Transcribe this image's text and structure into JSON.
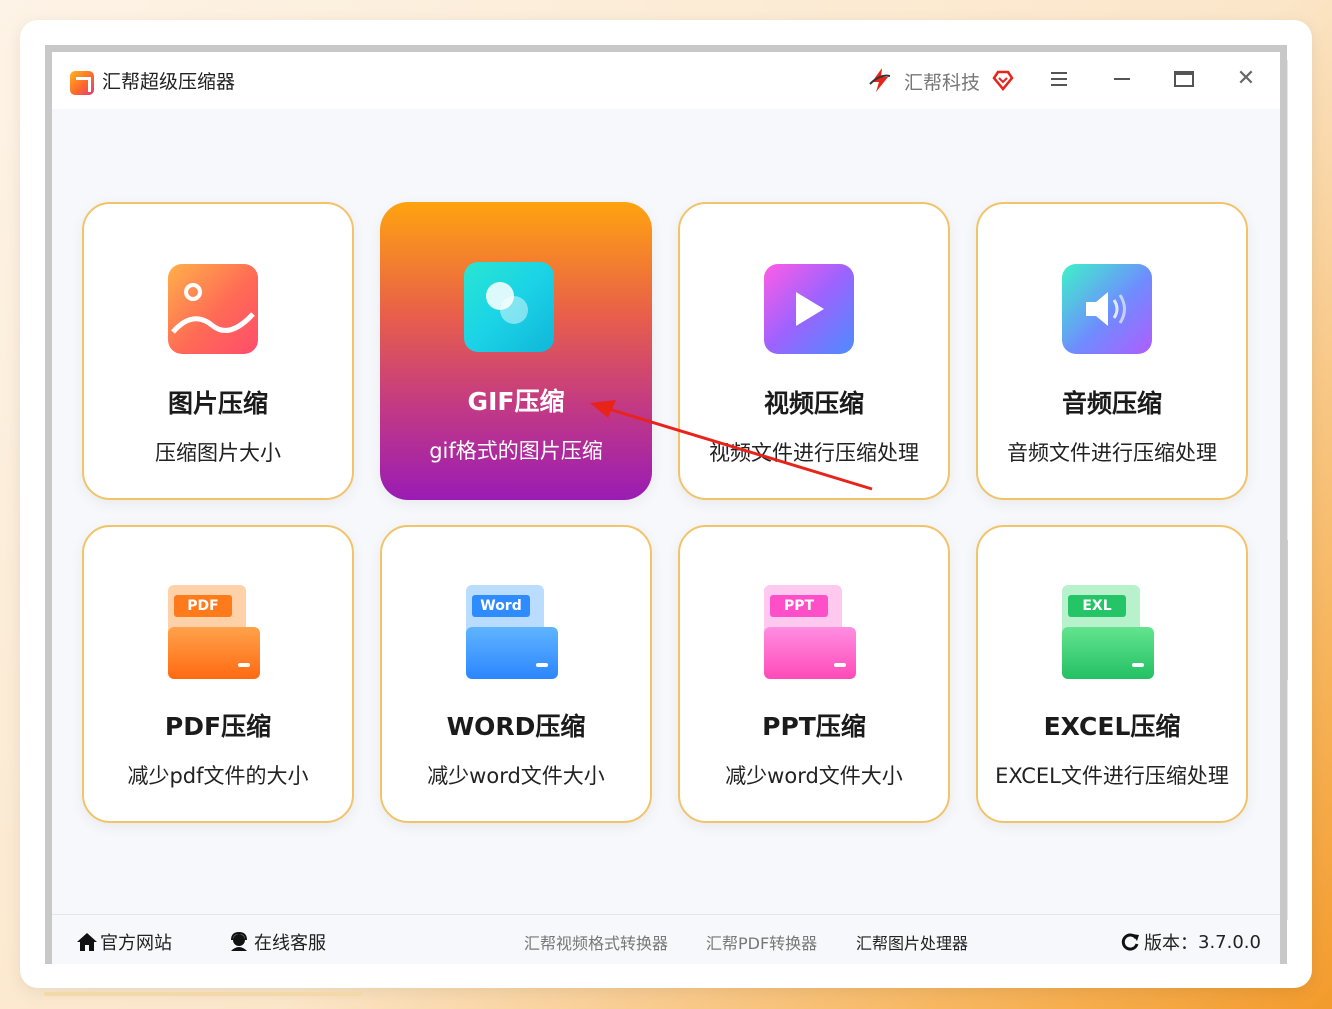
{
  "window": {
    "title": "汇帮超级压缩器",
    "brand": "汇帮科技"
  },
  "tiles": [
    {
      "title": "图片压缩",
      "desc": "压缩图片大小",
      "icon": "image-icon"
    },
    {
      "title": "GIF压缩",
      "desc": "gif格式的图片压缩",
      "icon": "gif-icon",
      "active": true
    },
    {
      "title": "视频压缩",
      "desc": "视频文件进行压缩处理",
      "icon": "video-play-icon"
    },
    {
      "title": "音频压缩",
      "desc": "音频文件进行压缩处理",
      "icon": "audio-speaker-icon"
    },
    {
      "title": "PDF压缩",
      "desc": "减少pdf文件的大小",
      "icon": "pdf-folder-icon",
      "tag": "PDF"
    },
    {
      "title": "WORD压缩",
      "desc": "减少word文件大小",
      "icon": "word-folder-icon",
      "tag": "Word"
    },
    {
      "title": "PPT压缩",
      "desc": "减少word文件大小",
      "icon": "ppt-folder-icon",
      "tag": "PPT"
    },
    {
      "title": "EXCEL压缩",
      "desc": "EXCEL文件进行压缩处理",
      "icon": "excel-folder-icon",
      "tag": "EXL"
    }
  ],
  "footer": {
    "official_site": "官方网站",
    "online_service": "在线客服",
    "links": [
      "汇帮视频格式转换器",
      "汇帮PDF转换器",
      "汇帮图片处理器"
    ],
    "version_label": "版本：",
    "version": "3.7.0.0"
  },
  "colors": {
    "accent_border": "#f2c46a",
    "active_gradient_top": "#ffa30f",
    "active_gradient_bottom": "#9a1cb4",
    "annotation_arrow": "#e8231a"
  }
}
